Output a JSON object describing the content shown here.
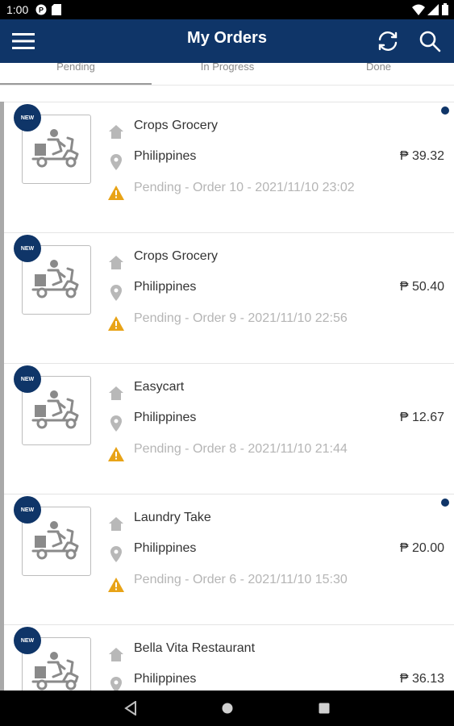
{
  "status_bar": {
    "time": "1:00",
    "icons": [
      "p-icon",
      "sd-card-icon",
      "wifi-icon",
      "signal-icon",
      "battery-icon"
    ]
  },
  "app_bar": {
    "title": "My Orders",
    "left_icon": "hamburger-menu-icon",
    "right_icons": [
      "refresh-icon",
      "search-icon"
    ]
  },
  "tabs": [
    {
      "label": "Pending",
      "selected": true
    },
    {
      "label": "In Progress",
      "selected": false
    },
    {
      "label": "Done",
      "selected": false
    }
  ],
  "orders": [
    {
      "badge": "NEW",
      "store": "Crops Grocery",
      "country": "Philippines",
      "price": "₱ 39.32",
      "status": "Pending - Order 10 - 2021/11/10 23:02",
      "unread": true
    },
    {
      "badge": "NEW",
      "store": "Crops Grocery",
      "country": "Philippines",
      "price": "₱ 50.40",
      "status": "Pending - Order 9 - 2021/11/10 22:56",
      "unread": false
    },
    {
      "badge": "NEW",
      "store": "Easycart",
      "country": "Philippines",
      "price": "₱ 12.67",
      "status": "Pending - Order 8 - 2021/11/10 21:44",
      "unread": false
    },
    {
      "badge": "NEW",
      "store": "Laundry Take",
      "country": "Philippines",
      "price": "₱ 20.00",
      "status": "Pending - Order 6 - 2021/11/10 15:30",
      "unread": true
    },
    {
      "badge": "NEW",
      "store": "Bella Vita Restaurant",
      "country": "Philippines",
      "price": "₱ 36.13",
      "status": "",
      "unread": false
    }
  ],
  "colors": {
    "brand": "#0f3568",
    "warning": "#e8a317",
    "muted_text": "#b5b5b5"
  },
  "nav_bar": {
    "icons": [
      "back-icon",
      "home-icon",
      "recents-icon"
    ]
  }
}
